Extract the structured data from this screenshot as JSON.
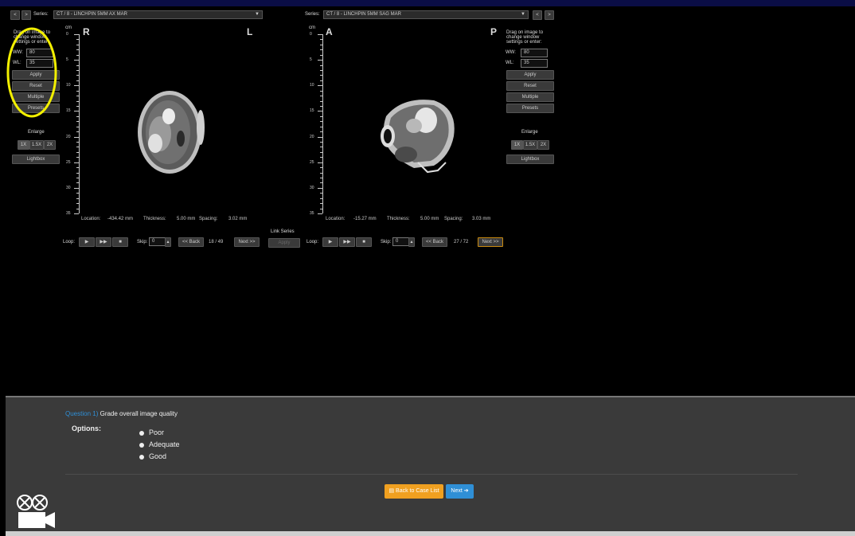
{
  "left_viewer": {
    "prev_label": "<",
    "next_label": ">",
    "series_label": "Series:",
    "series_value": "CT / 8 - LINCHPIN 5MM AX MAR",
    "orient_left": "R",
    "orient_right": "L",
    "ruler_unit": "cm",
    "ruler_ticks": [
      "0",
      "5",
      "10",
      "15",
      "20",
      "25",
      "30",
      "35"
    ],
    "location_label": "Location:",
    "location_value": "-434.42 mm",
    "thickness_label": "Thickness:",
    "thickness_value": "5.00 mm",
    "spacing_label": "Spacing:",
    "spacing_value": "3.02 mm",
    "loop_label": "Loop:",
    "skip_label": "Skip:",
    "skip_value": "0",
    "back_label": "<< Back",
    "frame_counter": "18 / 49",
    "next_label_btn": "Next >>"
  },
  "right_viewer": {
    "series_label": "Series:",
    "series_value": "CT / 8 - LINCHPIN 5MM SAG MAR",
    "prev_label": "<",
    "next_label": ">",
    "orient_left": "A",
    "orient_right": "P",
    "ruler_unit": "cm",
    "ruler_ticks": [
      "0",
      "5",
      "10",
      "15",
      "20",
      "25",
      "30",
      "35"
    ],
    "location_label": "Location:",
    "location_value": "-15.27 mm",
    "thickness_label": "Thickness:",
    "thickness_value": "5.00 mm",
    "spacing_label": "Spacing:",
    "spacing_value": "3.03 mm",
    "loop_label": "Loop:",
    "skip_label": "Skip:",
    "skip_value": "0",
    "back_label": "<< Back",
    "frame_counter": "27 / 72",
    "next_label_btn": "Next >>"
  },
  "left_controls": {
    "hint": "Drag on image to change window settings or enter:",
    "ww_label": "WW:",
    "ww_value": "80",
    "wl_label": "WL:",
    "wl_value": "35",
    "apply": "Apply",
    "reset": "Reset",
    "multiple": "Multiple",
    "presets": "Presets",
    "enlarge_label": "Enlarge",
    "enlarge_options": [
      "1X",
      "1.5X",
      "2X"
    ],
    "lightbox": "Lightbox",
    "highlight_color": "#f2ef00"
  },
  "right_controls": {
    "hint": "Drag on image to change window settings or enter:",
    "ww_label": "WW:",
    "ww_value": "80",
    "wl_label": "WL:",
    "wl_value": "35",
    "apply": "Apply",
    "reset": "Reset",
    "multiple": "Multiple",
    "presets": "Presets",
    "enlarge_label": "Enlarge",
    "enlarge_options": [
      "1X",
      "1.5X",
      "2X"
    ],
    "lightbox": "Lightbox"
  },
  "link_series": {
    "label": "Link Series",
    "button": "Apply"
  },
  "question": {
    "number": "Question 1)",
    "text": "Grade overall image quality",
    "options_label": "Options:",
    "options": [
      "Poor",
      "Adequate",
      "Good"
    ]
  },
  "actions": {
    "back_to_case_list": "Back to Case List",
    "next": "Next",
    "back_color": "#f0a020",
    "next_color": "#2f8fd6"
  },
  "icons": {
    "camera": "video-camera-icon"
  }
}
